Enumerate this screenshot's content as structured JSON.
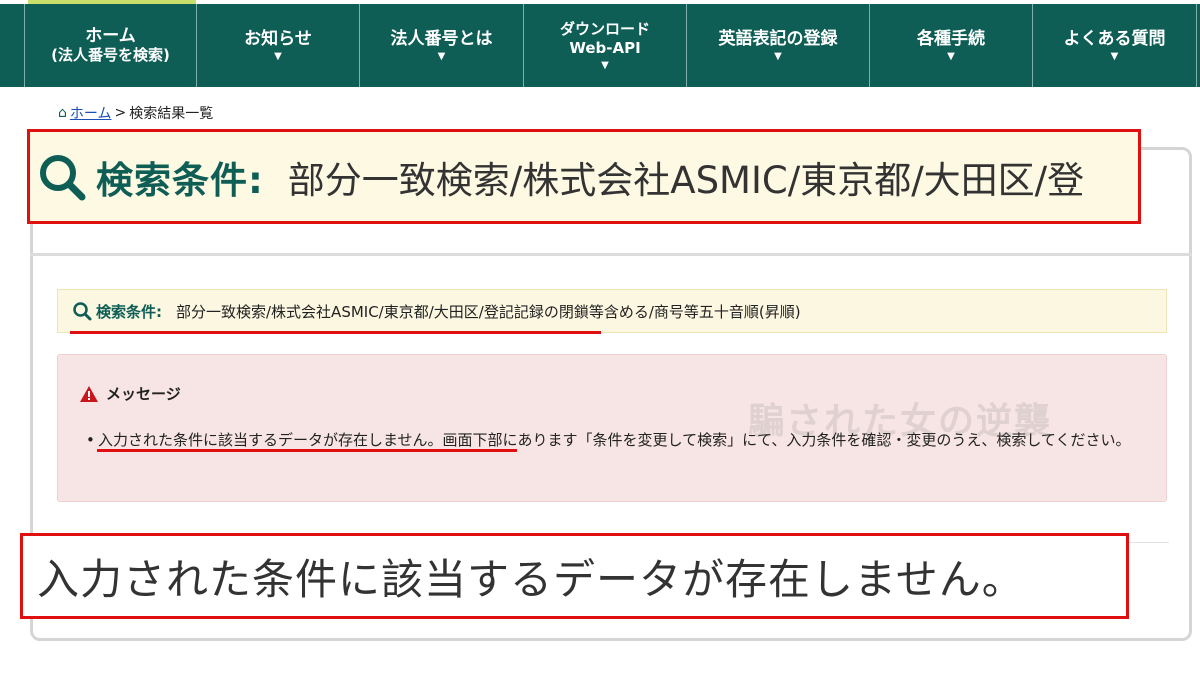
{
  "nav": {
    "items": [
      {
        "line1": "ホーム",
        "line2": "(法人番号を検索)"
      },
      {
        "line1": "お知らせ"
      },
      {
        "line1": "法人番号とは"
      },
      {
        "line1": "ダウンロード",
        "line2": "Web-API"
      },
      {
        "line1": "英語表記の登録"
      },
      {
        "line1": "各種手続"
      },
      {
        "line1": "よくある質問"
      }
    ]
  },
  "breadcrumb": {
    "home": "ホーム",
    "separator": ">",
    "current": "検索結果一覧"
  },
  "search_condition": {
    "label": "検索条件:",
    "big_value": "部分一致検索/株式会社ASMIC/東京都/大田区/登",
    "value": "部分一致検索/株式会社ASMIC/東京都/大田区/登記記録の閉鎖等含める/商号等五十音順(昇順)"
  },
  "message": {
    "title": "メッセージ",
    "bullet": "•",
    "body": "入力された条件に該当するデータが存在しません。画面下部にあります「条件を変更して検索」にて、入力条件を確認・変更のうえ、検索してください。",
    "highlight": "入力された条件に該当するデータが存在しません。"
  },
  "watermark": "騙された女の逆襲",
  "colors": {
    "nav_bg": "#0e5e56",
    "accent_red": "#e01010",
    "condition_bg": "#fbf7e1",
    "message_bg": "#f7e4e4"
  },
  "icons": {
    "breadcrumb_home": "home-icon",
    "condition": "search-icon",
    "message": "warning-icon",
    "nav_expand": "chevron-down-icon"
  }
}
